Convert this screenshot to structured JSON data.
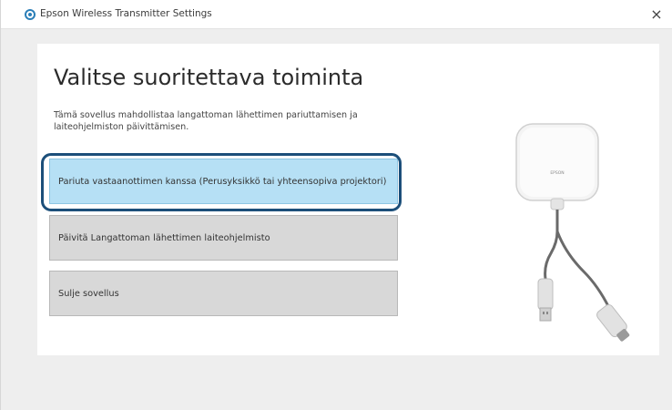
{
  "window": {
    "title": "Epson Wireless Transmitter Settings",
    "close_glyph": "×"
  },
  "main": {
    "heading": "Valitse suoritettava toiminta",
    "description": "Tämä sovellus mahdollistaa langattoman lähettimen pariuttamisen ja laiteohjelmiston päivittämisen.",
    "options": [
      {
        "label": "Pariuta vastaanottimen kanssa (Perusyksikkö tai yhteensopiva projektori)",
        "selected": true
      },
      {
        "label": "Päivitä Langattoman lähettimen laiteohjelmisto",
        "selected": false
      },
      {
        "label": "Sulje sovellus",
        "selected": false
      }
    ]
  },
  "device_image": {
    "brand_label": "EPSON"
  },
  "colors": {
    "selected_bg": "#b6e0f5",
    "button_bg": "#d8d8d8",
    "focus_ring": "#1c4f7a",
    "icon_blue": "#2c7fb8"
  }
}
